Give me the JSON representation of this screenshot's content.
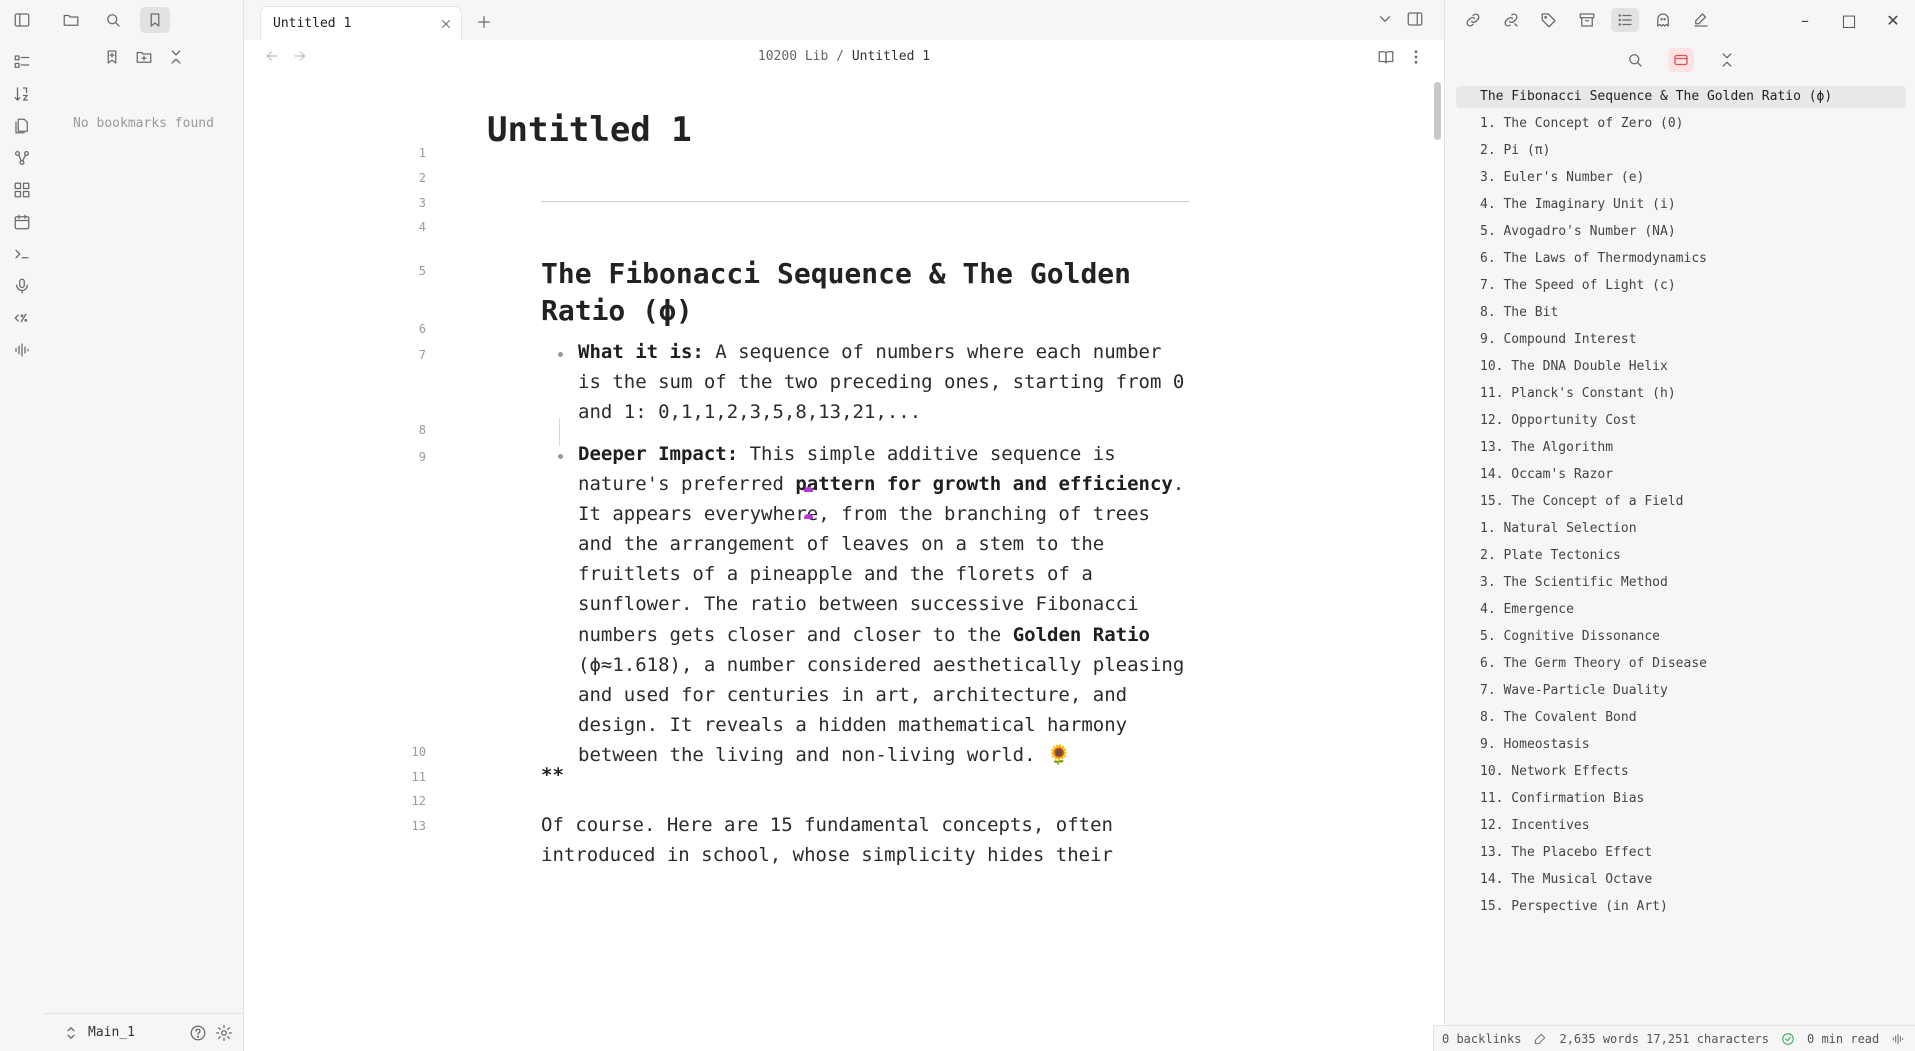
{
  "left_sidebar": {
    "empty_message": "No bookmarks found",
    "vault_name": "Main_1"
  },
  "tabs": [
    {
      "title": "Untitled 1",
      "active": true
    }
  ],
  "editor": {
    "breadcrumb": {
      "folder": "10200 Lib",
      "separator": "/",
      "current": "Untitled 1"
    },
    "title": "Untitled 1",
    "line_numbers": [
      "1",
      "2",
      "3",
      "4",
      "5",
      "6",
      "7",
      "8",
      "9",
      "10",
      "11",
      "12",
      "13"
    ],
    "heading": "The Fibonacci Sequence & The Golden Ratio (ϕ)",
    "bullet1": {
      "label": "What it is:",
      "text": " A sequence of numbers where each number is the sum of the two preceding ones, starting from 0 and 1: 0,1,1,2,3,5,8,13,21,..."
    },
    "bullet2": {
      "label": "Deeper Impact:",
      "text1": " This simple additive sequence is nature's preferred ",
      "bold1": "pattern for growth and efficiency",
      "text2": ". It appears everywhere, from the branching of trees and the arrangement of leaves on a stem to the fruitlets of a pineapple and the florets of a sunflower. The ratio between successive Fibonacci numbers gets closer and closer to the ",
      "bold2": "Golden Ratio",
      "text3": " (ϕ≈1.618), a number considered aesthetically pleasing and used for centuries in art, architecture, and design. It reveals a hidden mathematical harmony between the living and non-living world. ",
      "emoji": "🌻"
    },
    "stars": "**",
    "intro": "Of course. Here are 15 fundamental concepts, often introduced in school, whose simplicity hides their"
  },
  "outline": {
    "top": "The Fibonacci Sequence & The Golden Ratio (ϕ)",
    "items": [
      "1. The Concept of Zero (0)",
      "2. Pi (π)",
      "3. Euler's Number (e)",
      "4. The Imaginary Unit (i)",
      "5. Avogadro's Number (NA)",
      "6. The Laws of Thermodynamics",
      "7. The Speed of Light (c)",
      "8. The Bit",
      "9. Compound Interest",
      "10. The DNA Double Helix",
      "11. Planck's Constant (h)",
      "12. Opportunity Cost",
      "13. The Algorithm",
      "14. Occam's Razor",
      "15. The Concept of a Field",
      "1. Natural Selection",
      "2. Plate Tectonics",
      "3. The Scientific Method",
      "4. Emergence",
      "5. Cognitive Dissonance",
      "6. The Germ Theory of Disease",
      "7. Wave-Particle Duality",
      "8. The Covalent Bond",
      "9. Homeostasis",
      "10. Network Effects",
      "11. Confirmation Bias",
      "12. Incentives",
      "13. The Placebo Effect",
      "14. The Musical Octave",
      "15. Perspective (in Art)"
    ]
  },
  "status_bar": {
    "backlinks": "0 backlinks",
    "counts": "2,635 words 17,251 characters",
    "read_time": "0 min read"
  },
  "window_controls": {
    "minimize": "–",
    "maximize": "□",
    "close": "✕"
  }
}
